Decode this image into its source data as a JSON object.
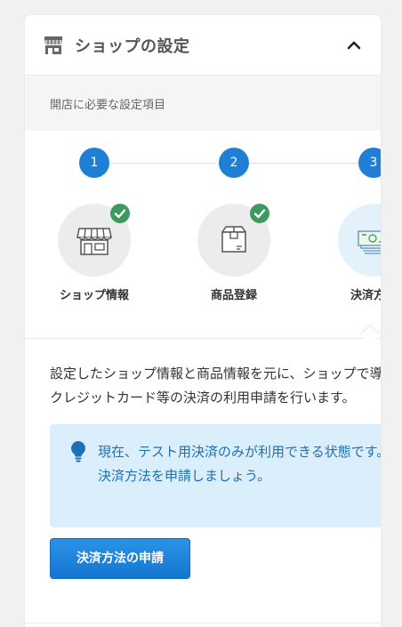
{
  "panel": {
    "title": "ショップの設定",
    "subtitle": "開店に必要な設定項目"
  },
  "steps": [
    {
      "number": "1",
      "label": "ショップ情報",
      "done": true,
      "icon": "storefront-icon"
    },
    {
      "number": "2",
      "label": "商品登録",
      "done": true,
      "icon": "package-icon"
    },
    {
      "number": "3",
      "label": "決済方法",
      "done": false,
      "icon": "payment-icon"
    }
  ],
  "main": {
    "description": "設定したショップ情報と商品情報を元に、ショップで導入するクレジットカード等の決済の利用申請を行います。",
    "notice_line1": "現在、テスト用決済のみが利用できる状態です。",
    "notice_line2": "決済方法を申請しましょう。",
    "apply_button": "決済方法の申請"
  },
  "colors": {
    "accent": "#1e7fd4",
    "check": "#3c9a5f",
    "notice_bg": "#dbeefc",
    "notice_text": "#1f6fb4"
  }
}
